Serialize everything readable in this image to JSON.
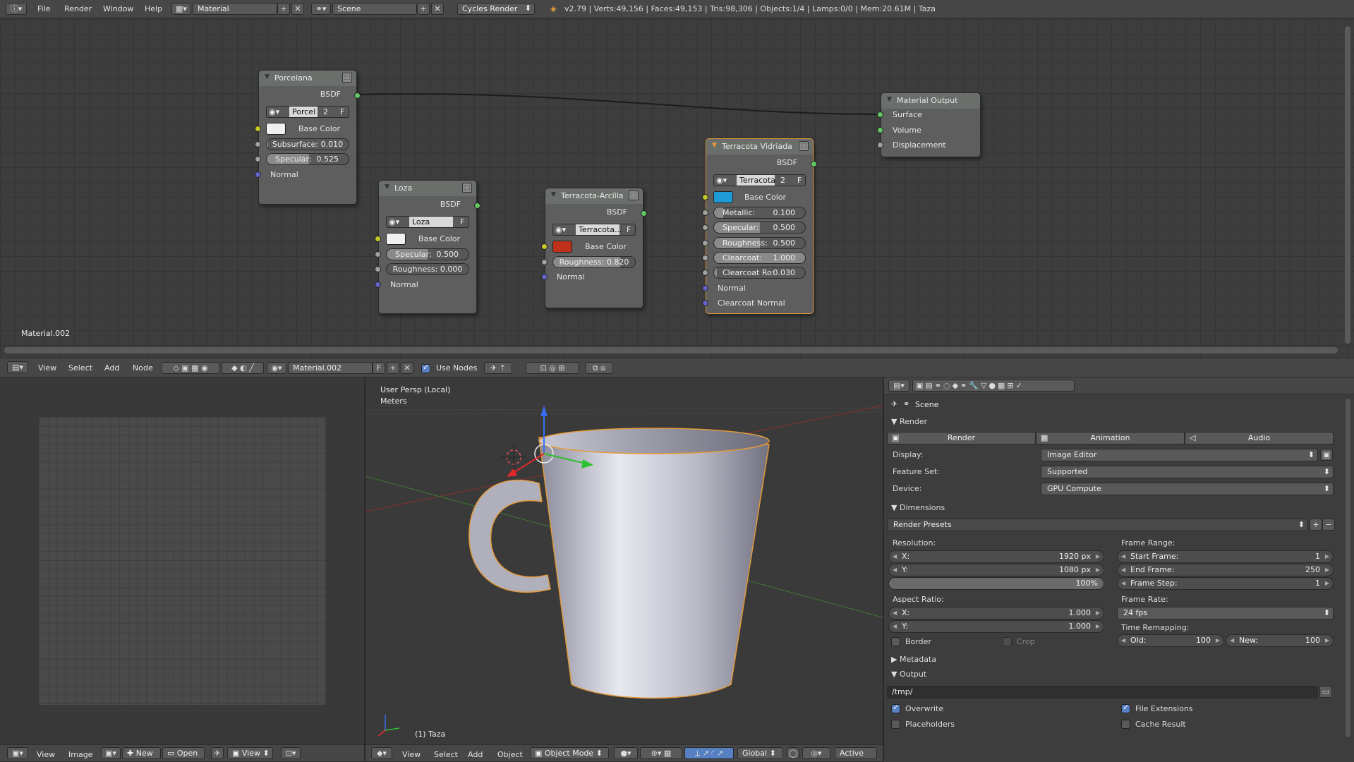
{
  "top_bar": {
    "menus": [
      "File",
      "Render",
      "Window",
      "Help"
    ],
    "screen_layout": "Material",
    "scene": "Scene",
    "engine": "Cycles Render",
    "stats": "v2.79 | Verts:49,156 | Faces:49,153 | Tris:98,306 | Objects:1/4 | Lamps:0/0 | Mem:20.61M | Taza"
  },
  "node_editor": {
    "material_label": "Material.002",
    "nodes": {
      "porcelana": {
        "title": "Porcelana",
        "output": "BSDF",
        "mat": "Porcel",
        "users": "2",
        "fake": "F",
        "base_color": "Base Color",
        "subsurface": "Subsurface: 0.010",
        "specular_label": "Specular:",
        "specular_value": "0.525",
        "normal": "Normal"
      },
      "loza": {
        "title": "Loza",
        "output": "BSDF",
        "mat": "Loza",
        "fake": "F",
        "base_color": "Base Color",
        "specular_label": "Specular:",
        "specular_value": "0.500",
        "roughness": "Roughness: 0.000",
        "normal": "Normal"
      },
      "arcilla": {
        "title": "Terracota-Arcilla",
        "output": "BSDF",
        "mat": "Terracota...",
        "fake": "F",
        "base_color": "Base Color",
        "roughness": "Roughness: 0.820",
        "normal": "Normal"
      },
      "vidriada": {
        "title": "Terracota Vidriada",
        "output": "BSDF",
        "mat": "Terracota",
        "users": "2",
        "fake": "F",
        "base_color": "Base Color",
        "metallic_label": "Metallic:",
        "metallic_value": "0.100",
        "specular_label": "Specular:",
        "specular_value": "0.500",
        "roughness_label": "Roughness:",
        "roughness_value": "0.500",
        "clearcoat_label": "Clearcoat:",
        "clearcoat_value": "1.000",
        "clearcoat_ro_label": "Clearcoat Ro:",
        "clearcoat_ro_value": "0.030",
        "normal": "Normal",
        "clearcoat_normal": "Clearcoat Normal"
      },
      "output": {
        "title": "Material Output",
        "surface": "Surface",
        "volume": "Volume",
        "displacement": "Displacement"
      }
    },
    "colors": {
      "white": "#f0f0f0",
      "blue": "#1e9ad6",
      "red": "#c0311c"
    }
  },
  "node_header": {
    "menus": [
      "View",
      "Select",
      "Add",
      "Node"
    ],
    "material": "Material.002",
    "fake": "F",
    "use_nodes": "Use Nodes"
  },
  "viewport": {
    "persp": "User Persp (Local)",
    "units": "Meters",
    "object_label": "(1) Taza"
  },
  "viewport_header": {
    "menus": [
      "View",
      "Select",
      "Add",
      "Object"
    ],
    "mode": "Object Mode",
    "orientation": "Global",
    "pivot": "Active"
  },
  "image_header": {
    "menus": [
      "View",
      "Image"
    ],
    "new": "New",
    "open": "Open",
    "view": "View"
  },
  "properties": {
    "breadcrumb": "Scene",
    "render_panel": "Render",
    "render_btn": "Render",
    "animation_btn": "Animation",
    "audio_btn": "Audio",
    "display_label": "Display:",
    "display_value": "Image Editor",
    "feature_label": "Feature Set:",
    "feature_value": "Supported",
    "device_label": "Device:",
    "device_value": "GPU Compute",
    "dimensions_panel": "Dimensions",
    "presets": "Render Presets",
    "resolution_label": "Resolution:",
    "res_x_label": "X:",
    "res_x": "1920 px",
    "res_y_label": "Y:",
    "res_y": "1080 px",
    "res_pct": "100%",
    "frame_range_label": "Frame Range:",
    "start_label": "Start Frame:",
    "start": "1",
    "end_label": "End Frame:",
    "end": "250",
    "step_label": "Frame Step:",
    "step": "1",
    "aspect_label": "Aspect Ratio:",
    "asp_x_label": "X:",
    "asp_x": "1.000",
    "asp_y_label": "Y:",
    "asp_y": "1.000",
    "frame_rate_label": "Frame Rate:",
    "frame_rate": "24 fps",
    "time_remap_label": "Time Remapping:",
    "old_label": "Old:",
    "old": "100",
    "new_label": "New:",
    "new": "100",
    "border": "Border",
    "crop": "Crop",
    "metadata_panel": "Metadata",
    "output_panel": "Output",
    "output_path": "/tmp/",
    "overwrite": "Overwrite",
    "file_ext": "File Extensions",
    "placeholders": "Placeholders",
    "cache_result": "Cache Result"
  }
}
